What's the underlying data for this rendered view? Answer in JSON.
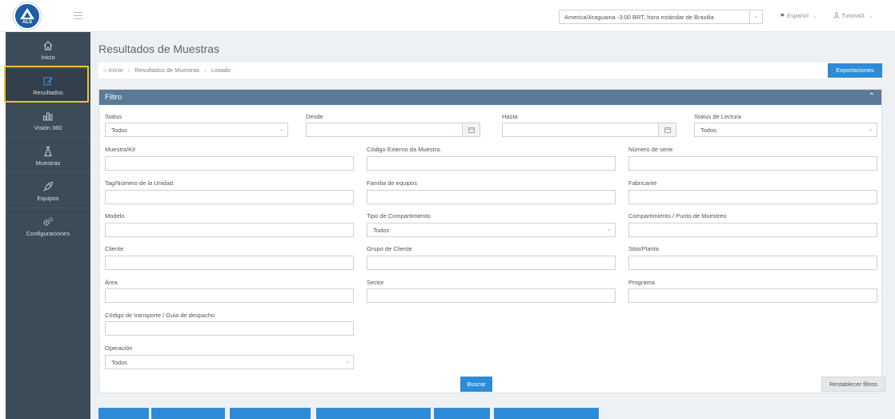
{
  "logo": {
    "text": "ALS"
  },
  "header": {
    "timezone": "America/Araguaina -3:00 BRT, hora estándar de Brasilia",
    "language": "Español",
    "user": "Tutorial3"
  },
  "sidebar": {
    "items": [
      {
        "label": "Inicio",
        "icon": "home-icon"
      },
      {
        "label": "Resultados",
        "icon": "pencil-icon"
      },
      {
        "label": "Visión 360",
        "icon": "bar-chart-icon"
      },
      {
        "label": "Muestras",
        "icon": "flask-icon"
      },
      {
        "label": "Equipos",
        "icon": "rocket-icon"
      },
      {
        "label": "Configuraciones",
        "icon": "gears-icon"
      }
    ]
  },
  "page": {
    "title": "Resultados de Muestras",
    "breadcrumb": [
      "Início",
      "Resultados de Muestras",
      "Listado"
    ],
    "export_label": "Exportaciones"
  },
  "filter": {
    "title": "Filtro",
    "status": {
      "label": "Status",
      "value": "Todos"
    },
    "desde": {
      "label": "Desde",
      "value": ""
    },
    "hasta": {
      "label": "Hasta",
      "value": ""
    },
    "status_lectura": {
      "label": "Status de Lectura",
      "value": "Todos"
    },
    "muestra_kit": {
      "label": "Muestra/Kit",
      "value": ""
    },
    "codigo_externo": {
      "label": "Código Externo da Muestra.",
      "value": ""
    },
    "numero_serie": {
      "label": "Número de serie",
      "value": ""
    },
    "tag_unidad": {
      "label": "Tag/Número de la Unidad",
      "value": ""
    },
    "familia_equipos": {
      "label": "Familia de equipos",
      "value": ""
    },
    "fabricante": {
      "label": "Fabricante",
      "value": ""
    },
    "modelo": {
      "label": "Modelo",
      "value": ""
    },
    "tipo_compartimiento": {
      "label": "Tipo de Compartimiento",
      "value": "Todos"
    },
    "compartimiento_punto": {
      "label": "Compartimiento / Punto de Muestreo",
      "value": ""
    },
    "cliente": {
      "label": "Cliente",
      "value": ""
    },
    "grupo_cliente": {
      "label": "Grupo de Cliente",
      "value": ""
    },
    "sitio_planta": {
      "label": "Sitio/Planta",
      "value": ""
    },
    "area": {
      "label": "Área",
      "value": ""
    },
    "sector": {
      "label": "Sector",
      "value": ""
    },
    "programa": {
      "label": "Programa",
      "value": ""
    },
    "codigo_transporte": {
      "label": "Código de transporte / Guia de despacho",
      "value": ""
    },
    "operacion": {
      "label": "Operación",
      "value": "Todos"
    },
    "search_label": "Buscar",
    "reset_label": "Restablecer filtros"
  },
  "colors": {
    "sidebar": "#3c4b58",
    "accent": "#2e8bd8",
    "panel_header": "#5b7a9a",
    "highlight": "#f2c12e"
  }
}
